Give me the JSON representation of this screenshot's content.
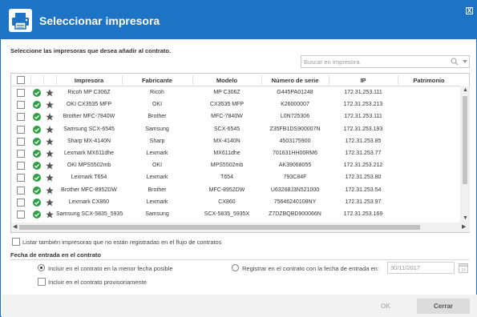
{
  "dialog": {
    "title": "Seleccionar impresora",
    "close_label": "X",
    "prompt": "Seleccione las impresoras que desea añadir al contrato."
  },
  "search": {
    "placeholder": "Buscar en Impresora"
  },
  "table": {
    "headers": [
      "Impresora",
      "Fabricante",
      "Modelo",
      "Número de serie",
      "IP",
      "Patrimonio"
    ],
    "rows": [
      {
        "impresora": "Ricoh MP C306Z",
        "fabricante": "Ricoh",
        "modelo": "MP C306Z",
        "serie": "G445PA01248",
        "ip": "172.31.253.111",
        "patrimonio": ""
      },
      {
        "impresora": "OKI CX3535 MFP",
        "fabricante": "OKI",
        "modelo": "CX3535 MFP",
        "serie": "K26000007",
        "ip": "172.31.253.213",
        "patrimonio": ""
      },
      {
        "impresora": "Brother MFC-7840W",
        "fabricante": "Brother",
        "modelo": "MFC-7840W",
        "serie": "L0N725306",
        "ip": "172.31.253.111",
        "patrimonio": ""
      },
      {
        "impresora": "Samsung SCX-6545",
        "fabricante": "Samsung",
        "modelo": "SCX-6545",
        "serie": "Z35FB1DS900007N",
        "ip": "172.31.253.193",
        "patrimonio": ""
      },
      {
        "impresora": "Sharp MX-4140N",
        "fabricante": "Sharp",
        "modelo": "MX-4140N",
        "serie": "4503175900",
        "ip": "172.31.253.85",
        "patrimonio": ""
      },
      {
        "impresora": "Lexmark MX611dhe",
        "fabricante": "Lexmark",
        "modelo": "MX611dhe",
        "serie": "701631HH00RM6",
        "ip": "172.31.253.77",
        "patrimonio": ""
      },
      {
        "impresora": "OKI MPS5502mb",
        "fabricante": "OKI",
        "modelo": "MPS5502mb",
        "serie": "AK39068055",
        "ip": "172.31.253.212",
        "patrimonio": ""
      },
      {
        "impresora": "Lexmark T654",
        "fabricante": "Lexmark",
        "modelo": "T654",
        "serie": "793C84F",
        "ip": "172.31.253.80",
        "patrimonio": ""
      },
      {
        "impresora": "Brother MFC-8952DW",
        "fabricante": "Brother",
        "modelo": "MFC-8952DW",
        "serie": "U63268J3N521000",
        "ip": "172.31.253.54",
        "patrimonio": ""
      },
      {
        "impresora": "Lexmark CX860",
        "fabricante": "Lexmark",
        "modelo": "CX860",
        "serie": "75646240108NY",
        "ip": "172.31.253.97",
        "patrimonio": ""
      },
      {
        "impresora": "Samsung SCX-5835_5935",
        "fabricante": "Samsung",
        "modelo": "SCX-5835_5935X",
        "serie": "Z7DZBQBD900066N",
        "ip": "172.31.253.169",
        "patrimonio": ""
      }
    ]
  },
  "options": {
    "list_unregistered": "Listar también impresoras que no están registradas en el flujo de contratos",
    "entry_date_title": "Fecha de entrada en el contrato",
    "radio_earliest": "Incluir en el contrato en la menor fecha posible",
    "radio_register": "Registrar en el contrato con la fecha de entrada en:",
    "date_value": "30/11/2017",
    "calendar_day": "15",
    "provisional": "Incluir en el contrato provisoriamente"
  },
  "footer": {
    "ok_label": "OK",
    "cancel_label": "Cerrar"
  },
  "colors": {
    "accent": "#1e74c4",
    "status_ok": "#2f9e44",
    "star": "#555555"
  }
}
